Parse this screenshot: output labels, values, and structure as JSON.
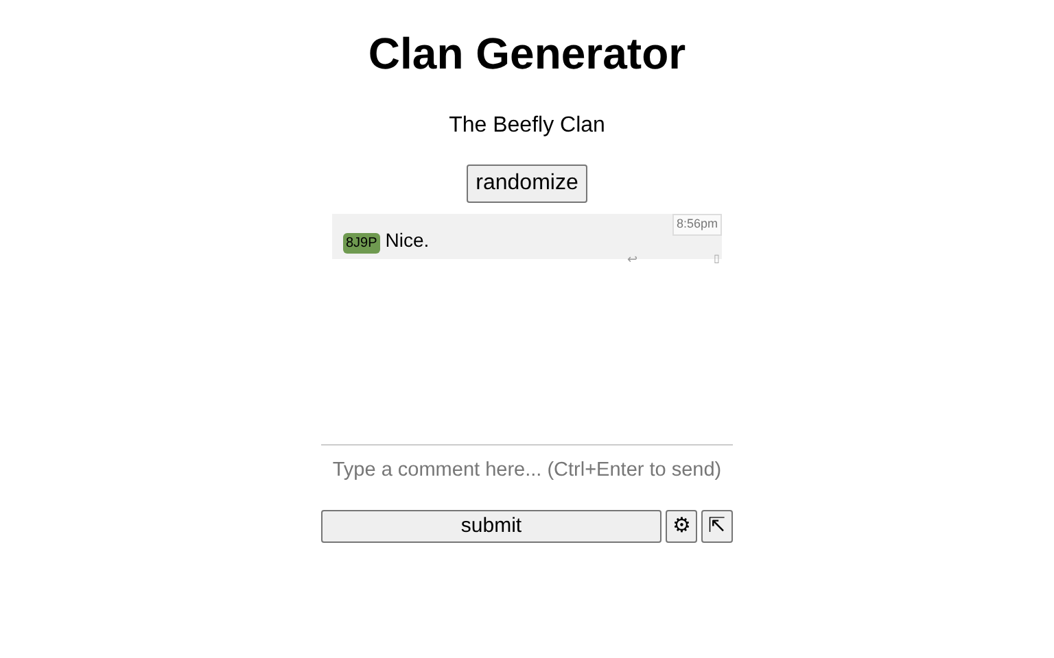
{
  "title": "Clan Generator",
  "clan_name": "The Beefly Clan",
  "randomize_button": "randomize",
  "comments": [
    {
      "user_tag": "8J9P",
      "color": "#6f9a50",
      "text": "Nice.",
      "time": "8:56pm",
      "reply_glyph": "↩",
      "menu_glyph": "▯"
    }
  ],
  "comment_box": {
    "placeholder": "Type a comment here... (Ctrl+Enter to send)"
  },
  "submit_button": "submit",
  "settings_button": "⚙",
  "popout_button": "⇱"
}
